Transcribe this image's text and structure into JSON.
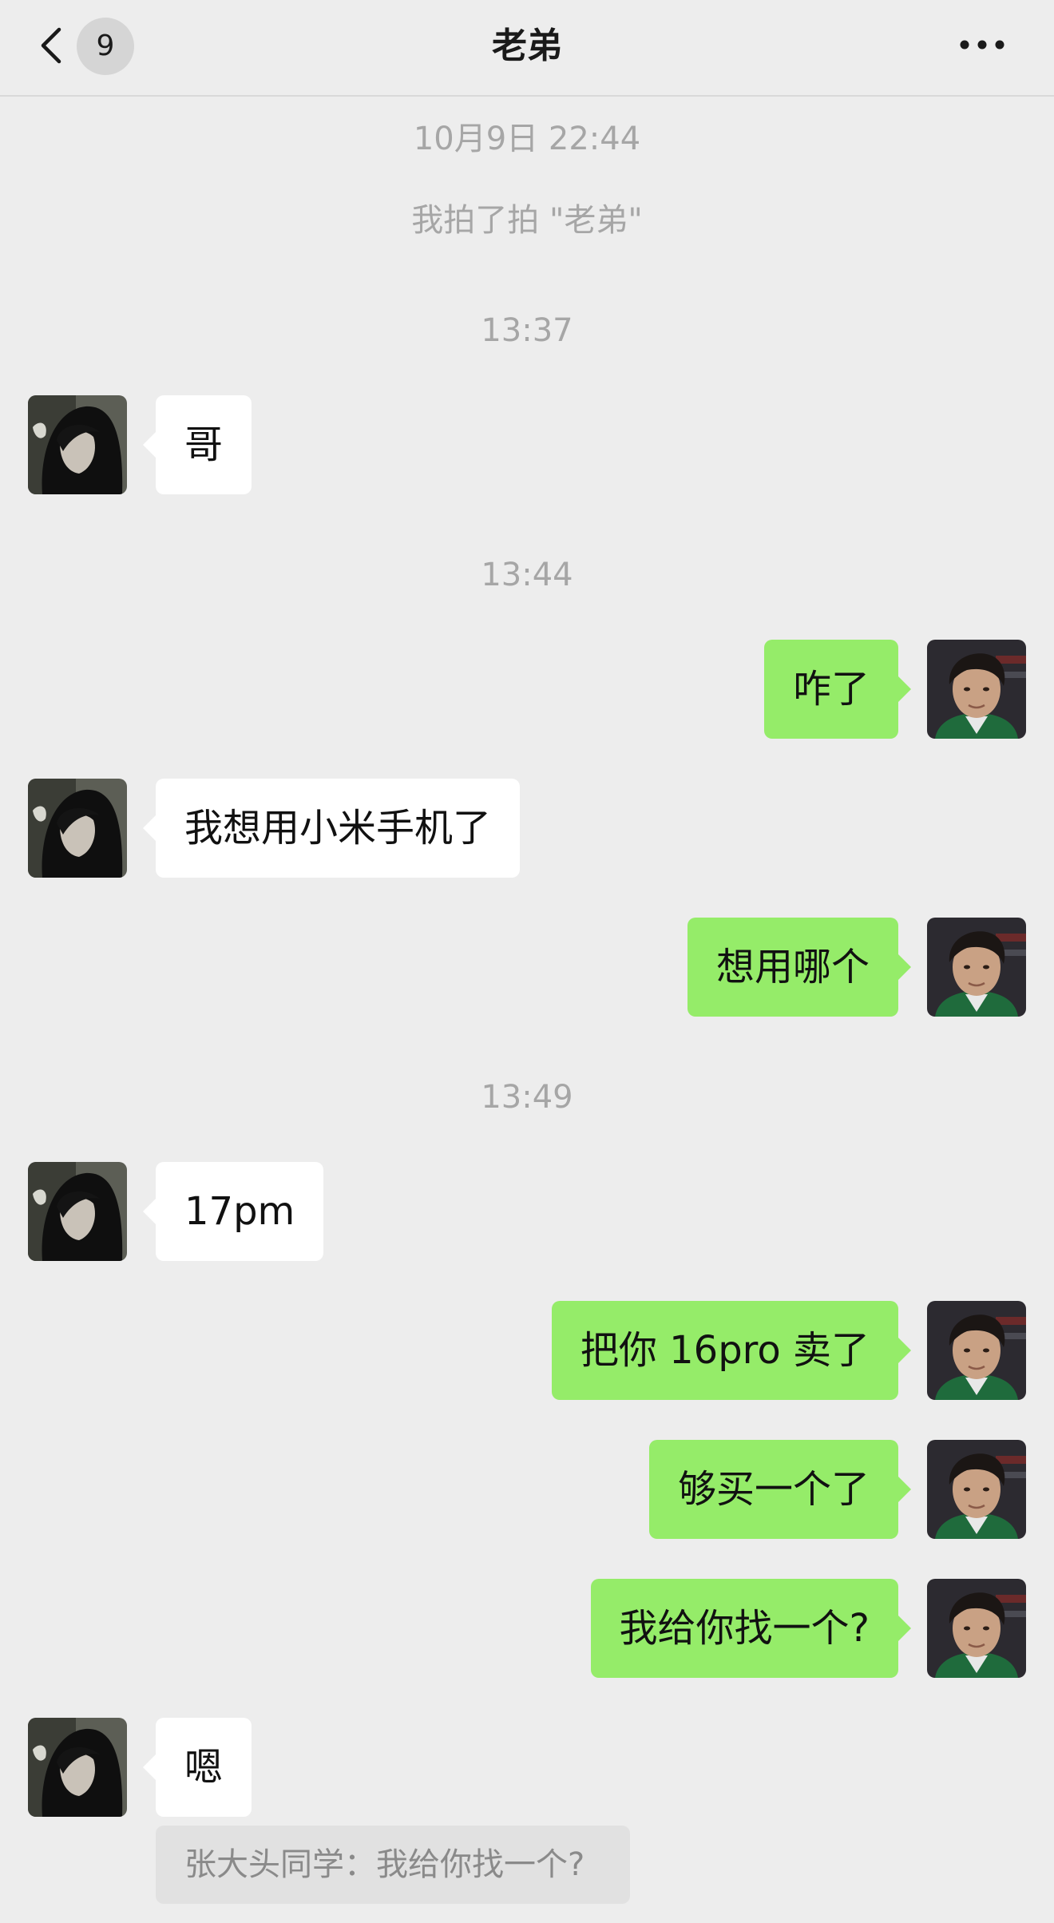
{
  "header": {
    "title": "老弟",
    "unread_count": "9",
    "back_icon": "chevron-left-icon",
    "more_icon": "more-dots-icon"
  },
  "chat": {
    "timestamps": [
      "10月9日 22:44",
      "13:37",
      "13:44",
      "13:49"
    ],
    "system_notice": "我拍了拍 \"老弟\"",
    "messages": [
      {
        "sender": "contact",
        "text": "哥"
      },
      {
        "sender": "me",
        "text": "咋了"
      },
      {
        "sender": "contact",
        "text": "我想用小米手机了"
      },
      {
        "sender": "me",
        "text": "想用哪个"
      },
      {
        "sender": "contact",
        "text": "17pm"
      },
      {
        "sender": "me",
        "text": "把你 16pro 卖了"
      },
      {
        "sender": "me",
        "text": "够买一个了"
      },
      {
        "sender": "me",
        "text": "我给你找一个?"
      },
      {
        "sender": "contact",
        "text": "嗯"
      }
    ],
    "quote": "张大头同学：我给你找一个?"
  },
  "colors": {
    "background": "#ededed",
    "outgoing_bubble": "#95ec69",
    "incoming_bubble": "#ffffff",
    "meta_text": "#a6a6a6"
  }
}
